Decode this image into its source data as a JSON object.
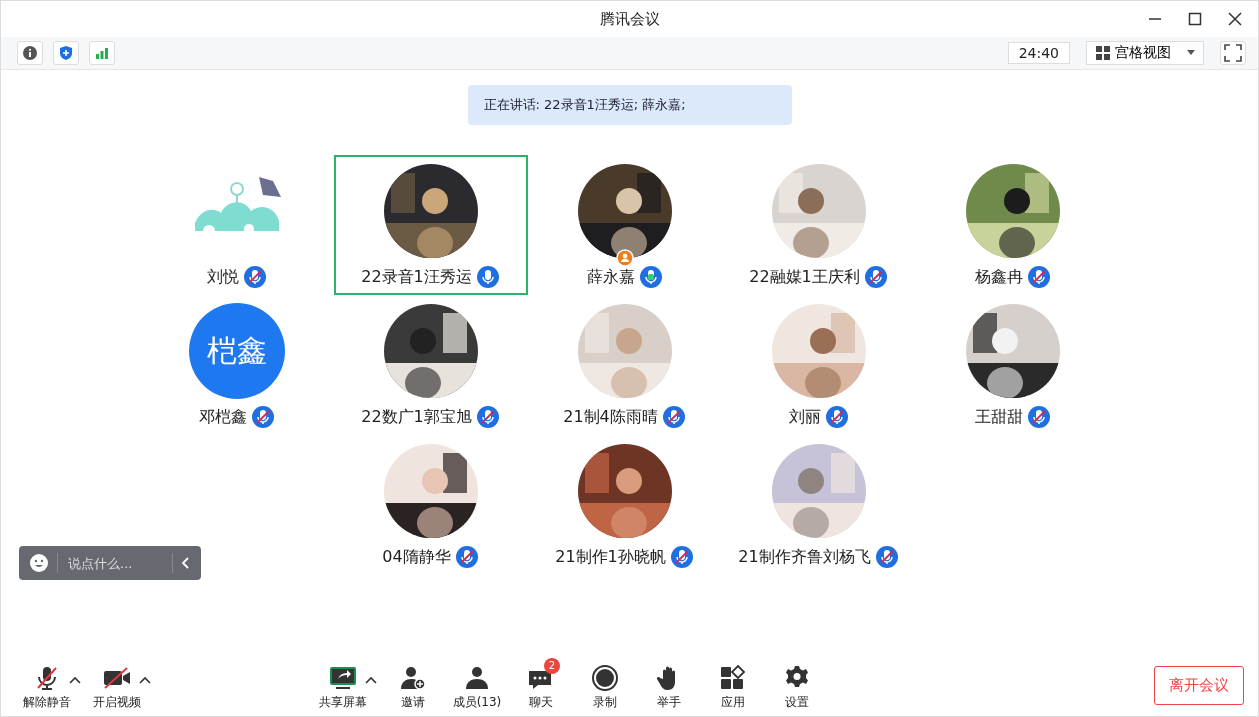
{
  "window": {
    "title": "腾讯会议"
  },
  "topbar": {
    "timer": "24:40",
    "view": "宫格视图"
  },
  "speaking_banner": "正在讲话: 22录音1汪秀运; 薛永嘉;",
  "participants": [
    {
      "name": "刘悦",
      "kind": "drawing",
      "muted": true,
      "speaking": false,
      "selected": false,
      "host": false
    },
    {
      "name": "22录音1汪秀运",
      "kind": "picture",
      "muted": false,
      "speaking": false,
      "selected": true,
      "host": false
    },
    {
      "name": "薛永嘉",
      "kind": "picture",
      "muted": false,
      "speaking": true,
      "selected": false,
      "host": true
    },
    {
      "name": "22融媒1王庆利",
      "kind": "picture",
      "muted": true,
      "speaking": false,
      "selected": false,
      "host": false
    },
    {
      "name": "杨鑫冉",
      "kind": "picture",
      "muted": true,
      "speaking": false,
      "selected": false,
      "host": false
    },
    {
      "name": "邓桤鑫",
      "kind": "text",
      "avatar_text": "桤鑫",
      "muted": true,
      "speaking": false,
      "selected": false,
      "host": false
    },
    {
      "name": "22数广1郭宝旭",
      "kind": "picture",
      "muted": true,
      "speaking": false,
      "selected": false,
      "host": false
    },
    {
      "name": "21制4陈雨晴",
      "kind": "picture",
      "muted": true,
      "speaking": false,
      "selected": false,
      "host": false
    },
    {
      "name": "刘丽",
      "kind": "picture",
      "muted": true,
      "speaking": false,
      "selected": false,
      "host": false
    },
    {
      "name": "王甜甜",
      "kind": "picture",
      "muted": true,
      "speaking": false,
      "selected": false,
      "host": false
    },
    {
      "name": "04隋静华",
      "kind": "picture",
      "muted": true,
      "speaking": false,
      "selected": false,
      "host": false
    },
    {
      "name": "21制作1孙晓帆",
      "kind": "picture",
      "muted": true,
      "speaking": false,
      "selected": false,
      "host": false
    },
    {
      "name": "21制作齐鲁刘杨飞",
      "kind": "picture",
      "muted": true,
      "speaking": false,
      "selected": false,
      "host": false
    }
  ],
  "chat_input": {
    "placeholder": "说点什么..."
  },
  "toolbar_left": [
    {
      "kind": "mic",
      "label": "解除静音",
      "off": true,
      "menu": true
    },
    {
      "kind": "video",
      "label": "开启视频",
      "off": true,
      "menu": true
    }
  ],
  "toolbar_center": [
    {
      "kind": "share",
      "label": "共享屏幕",
      "menu": true
    },
    {
      "kind": "invite",
      "label": "邀请",
      "menu": false
    },
    {
      "kind": "members",
      "label": "成员(13)",
      "menu": false
    },
    {
      "kind": "chat",
      "label": "聊天",
      "badge": "2",
      "menu": false
    },
    {
      "kind": "record",
      "label": "录制",
      "menu": false
    },
    {
      "kind": "hand",
      "label": "举手",
      "menu": false
    },
    {
      "kind": "apps",
      "label": "应用",
      "menu": false
    },
    {
      "kind": "settings",
      "label": "设置",
      "menu": false
    }
  ],
  "leave_button": "离开会议"
}
